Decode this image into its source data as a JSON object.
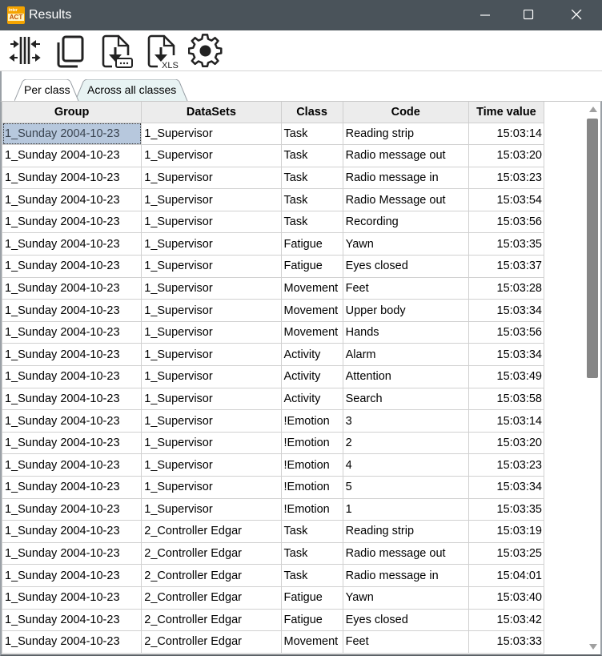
{
  "window": {
    "title": "Results",
    "app_icon": {
      "top_text": "inter",
      "bottom_text": "ACT"
    },
    "controls": {
      "minimize": "minimize-icon",
      "maximize": "maximize-icon",
      "close": "close-icon"
    },
    "titlebar_color": "#4a535a"
  },
  "toolbar": {
    "buttons": [
      {
        "name": "adjust-columns",
        "icon": "column-width-icon"
      },
      {
        "name": "copy",
        "icon": "copy-icon"
      },
      {
        "name": "export-text",
        "icon": "download-text-icon"
      },
      {
        "name": "export-xls",
        "icon": "download-xls-icon",
        "badge": "XLS"
      },
      {
        "name": "settings",
        "icon": "gear-icon"
      }
    ]
  },
  "tabs": [
    {
      "label": "Per class",
      "active": true
    },
    {
      "label": "Across all classes",
      "active": false
    }
  ],
  "grid": {
    "columns": [
      "Group",
      "DataSets",
      "Class",
      "Code",
      "Time value"
    ],
    "selected_cell": {
      "row": 0,
      "col": 0
    },
    "selection_color": "#b7c8dd",
    "rows": [
      [
        "1_Sunday 2004-10-23",
        "1_Supervisor",
        "Task",
        "Reading strip",
        "15:03:14"
      ],
      [
        "1_Sunday 2004-10-23",
        "1_Supervisor",
        "Task",
        "Radio message out",
        "15:03:20"
      ],
      [
        "1_Sunday 2004-10-23",
        "1_Supervisor",
        "Task",
        "Radio message in",
        "15:03:23"
      ],
      [
        "1_Sunday 2004-10-23",
        "1_Supervisor",
        "Task",
        "Radio Message out",
        "15:03:54"
      ],
      [
        "1_Sunday 2004-10-23",
        "1_Supervisor",
        "Task",
        "Recording",
        "15:03:56"
      ],
      [
        "1_Sunday 2004-10-23",
        "1_Supervisor",
        "Fatigue",
        "Yawn",
        "15:03:35"
      ],
      [
        "1_Sunday 2004-10-23",
        "1_Supervisor",
        "Fatigue",
        "Eyes closed",
        "15:03:37"
      ],
      [
        "1_Sunday 2004-10-23",
        "1_Supervisor",
        "Movement",
        "Feet",
        "15:03:28"
      ],
      [
        "1_Sunday 2004-10-23",
        "1_Supervisor",
        "Movement",
        "Upper body",
        "15:03:34"
      ],
      [
        "1_Sunday 2004-10-23",
        "1_Supervisor",
        "Movement",
        "Hands",
        "15:03:56"
      ],
      [
        "1_Sunday 2004-10-23",
        "1_Supervisor",
        "Activity",
        "Alarm",
        "15:03:34"
      ],
      [
        "1_Sunday 2004-10-23",
        "1_Supervisor",
        "Activity",
        "Attention",
        "15:03:49"
      ],
      [
        "1_Sunday 2004-10-23",
        "1_Supervisor",
        "Activity",
        "Search",
        "15:03:58"
      ],
      [
        "1_Sunday 2004-10-23",
        "1_Supervisor",
        "!Emotion",
        "3",
        "15:03:14"
      ],
      [
        "1_Sunday 2004-10-23",
        "1_Supervisor",
        "!Emotion",
        "2",
        "15:03:20"
      ],
      [
        "1_Sunday 2004-10-23",
        "1_Supervisor",
        "!Emotion",
        "4",
        "15:03:23"
      ],
      [
        "1_Sunday 2004-10-23",
        "1_Supervisor",
        "!Emotion",
        "5",
        "15:03:34"
      ],
      [
        "1_Sunday 2004-10-23",
        "1_Supervisor",
        "!Emotion",
        "1",
        "15:03:35"
      ],
      [
        "1_Sunday 2004-10-23",
        "2_Controller Edgar",
        "Task",
        "Reading strip",
        "15:03:19"
      ],
      [
        "1_Sunday 2004-10-23",
        "2_Controller Edgar",
        "Task",
        "Radio message out",
        "15:03:25"
      ],
      [
        "1_Sunday 2004-10-23",
        "2_Controller Edgar",
        "Task",
        "Radio message in",
        "15:04:01"
      ],
      [
        "1_Sunday 2004-10-23",
        "2_Controller Edgar",
        "Fatigue",
        "Yawn",
        "15:03:40"
      ],
      [
        "1_Sunday 2004-10-23",
        "2_Controller Edgar",
        "Fatigue",
        "Eyes closed",
        "15:03:42"
      ],
      [
        "1_Sunday 2004-10-23",
        "2_Controller Edgar",
        "Movement",
        "Feet",
        "15:03:33"
      ]
    ]
  },
  "scrollbar": {
    "position": 0,
    "visible_fraction": 0.49
  }
}
